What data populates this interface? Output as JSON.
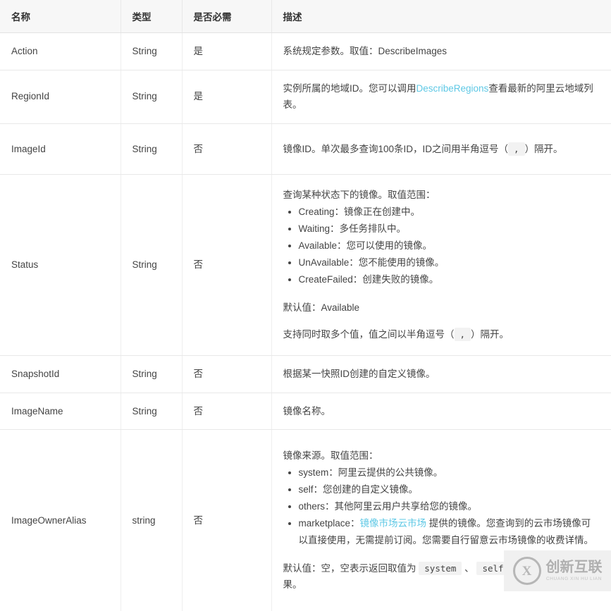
{
  "table": {
    "headers": [
      "名称",
      "类型",
      "是否必需",
      "描述"
    ],
    "rows": [
      {
        "name": "Action",
        "type": "String",
        "required": "是",
        "desc": {
          "lead": "系统规定参数。取值：DescribeImages"
        }
      },
      {
        "name": "RegionId",
        "type": "String",
        "required": "是",
        "desc": {
          "lead_before_link": "实例所属的地域ID。您可以调用",
          "link": "DescribeRegions",
          "lead_after_link": "查看最新的阿里云地域列表。"
        }
      },
      {
        "name": "ImageId",
        "type": "String",
        "required": "否",
        "desc": {
          "before_code": "镜像ID。单次最多查询100条ID，ID之间用半角逗号（",
          "code": ",",
          "after_code": "）隔开。"
        }
      },
      {
        "name": "Status",
        "type": "String",
        "required": "否",
        "desc": {
          "lead": "查询某种状态下的镜像。取值范围：",
          "bullets": [
            "Creating：镜像正在创建中。",
            "Waiting：多任务排队中。",
            "Available：您可以使用的镜像。",
            "UnAvailable：您不能使用的镜像。",
            "CreateFailed：创建失败的镜像。"
          ],
          "default_note": "默认值：Available",
          "multi_before_code": "支持同时取多个值，值之间以半角逗号（",
          "multi_code": ",",
          "multi_after_code": "）隔开。"
        }
      },
      {
        "name": "SnapshotId",
        "type": "String",
        "required": "否",
        "desc": {
          "lead": "根据某一快照ID创建的自定义镜像。"
        }
      },
      {
        "name": "ImageName",
        "type": "String",
        "required": "否",
        "desc": {
          "lead": "镜像名称。"
        }
      },
      {
        "name": "ImageOwnerAlias",
        "type": "string",
        "required": "否",
        "desc": {
          "lead": "镜像来源。取值范围：",
          "bullets": [
            "system：阿里云提供的公共镜像。",
            "self：您创建的自定义镜像。",
            "others：其他阿里云用户共享给您的镜像。"
          ],
          "marketplace_before_link": "marketplace：",
          "marketplace_link": "镜像市场云市场",
          "marketplace_after_link": " 提供的镜像。您查询到的云市场镜像可以直接使用，无需提前订阅。您需要自行留意云市场镜像的收费详情。",
          "default_before_code1": "默认值：空，空表示返回取值为 ",
          "default_code1": "system",
          "default_mid1": " 、 ",
          "default_code2": "self",
          "default_mid2": " 及 ",
          "default_code3": "others",
          "default_tail": " 的结果。"
        }
      }
    ]
  },
  "watermark": {
    "mark": "X",
    "cn": "创新互联",
    "en": "CHUANG XIN HU LIAN"
  }
}
